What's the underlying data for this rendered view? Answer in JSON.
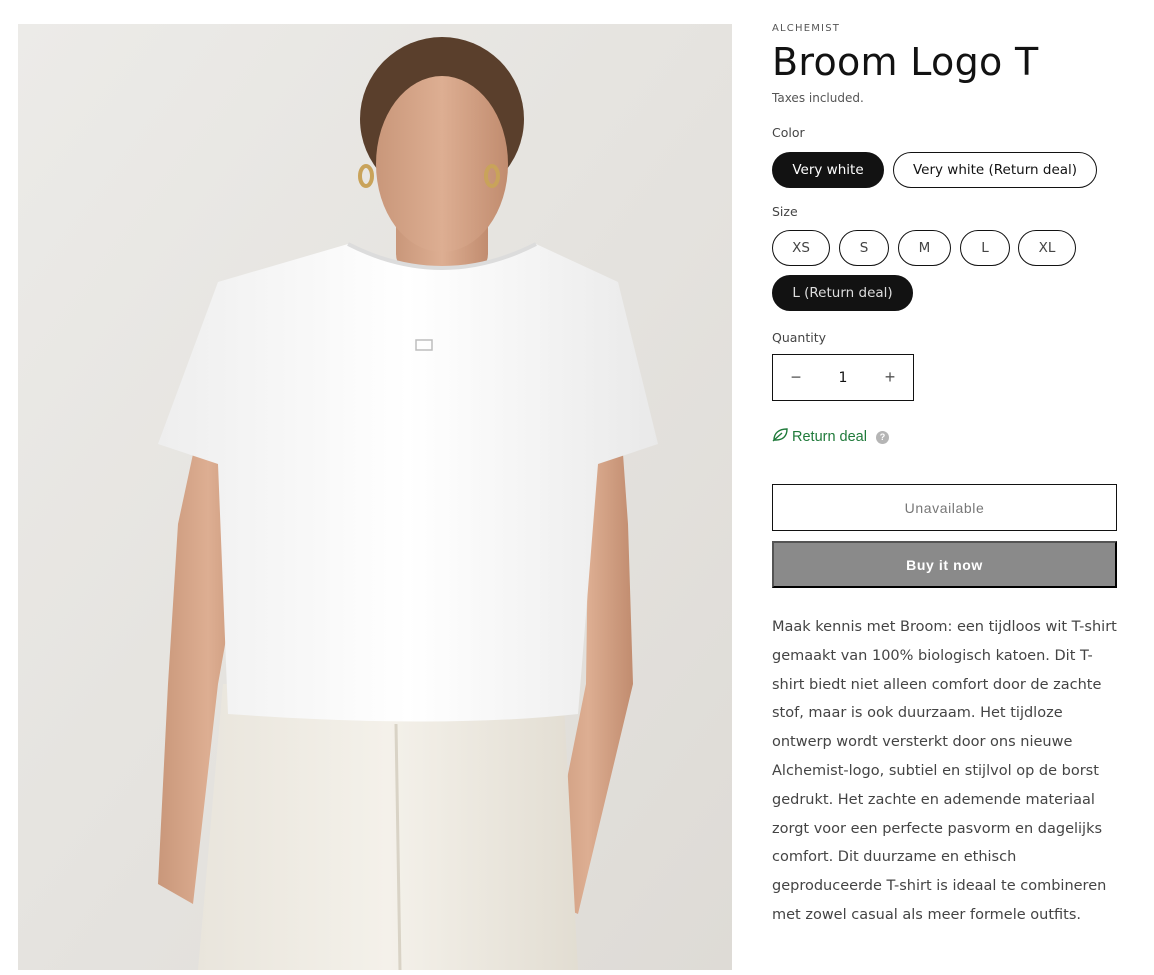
{
  "product": {
    "vendor": "ALCHEMIST",
    "title": "Broom Logo T",
    "taxes_note": "Taxes included.",
    "media_alt": "Woman wearing the white Broom Logo T-shirt with cream trousers"
  },
  "options": {
    "color": {
      "label": "Color",
      "values": [
        "Very white",
        "Very white (Return deal)"
      ],
      "selected": "Very white"
    },
    "size": {
      "label": "Size",
      "values": [
        "XS",
        "S",
        "M",
        "L",
        "XL",
        "L (Return deal)"
      ],
      "selected": "L (Return deal)"
    }
  },
  "quantity": {
    "label": "Quantity",
    "value": "1",
    "decrease_symbol": "−",
    "increase_symbol": "+"
  },
  "return_deal": {
    "label": "Return deal",
    "help_symbol": "?",
    "icon": "leaf-icon",
    "color": "#1f7a3a"
  },
  "actions": {
    "unavailable_label": "Unavailable",
    "buy_now_label": "Buy it now"
  },
  "description": "Maak kennis met Broom: een tijdloos wit T-shirt gemaakt van 100% biologisch katoen. Dit T-shirt biedt niet alleen comfort door de zachte stof, maar is ook duurzaam. Het tijdloze ontwerp wordt versterkt door ons nieuwe Alchemist-logo, subtiel en stijlvol op de borst gedrukt. Het zachte en ademende materiaal zorgt voor een perfecte pasvorm en dagelijks comfort. Dit duurzame en ethisch geproduceerde T-shirt is ideaal te combineren met zowel casual als meer formele outfits.",
  "colors": {
    "text": "#121212",
    "buy_button_bg": "#8a8a8a",
    "media_bg": "#e8e6e2"
  }
}
